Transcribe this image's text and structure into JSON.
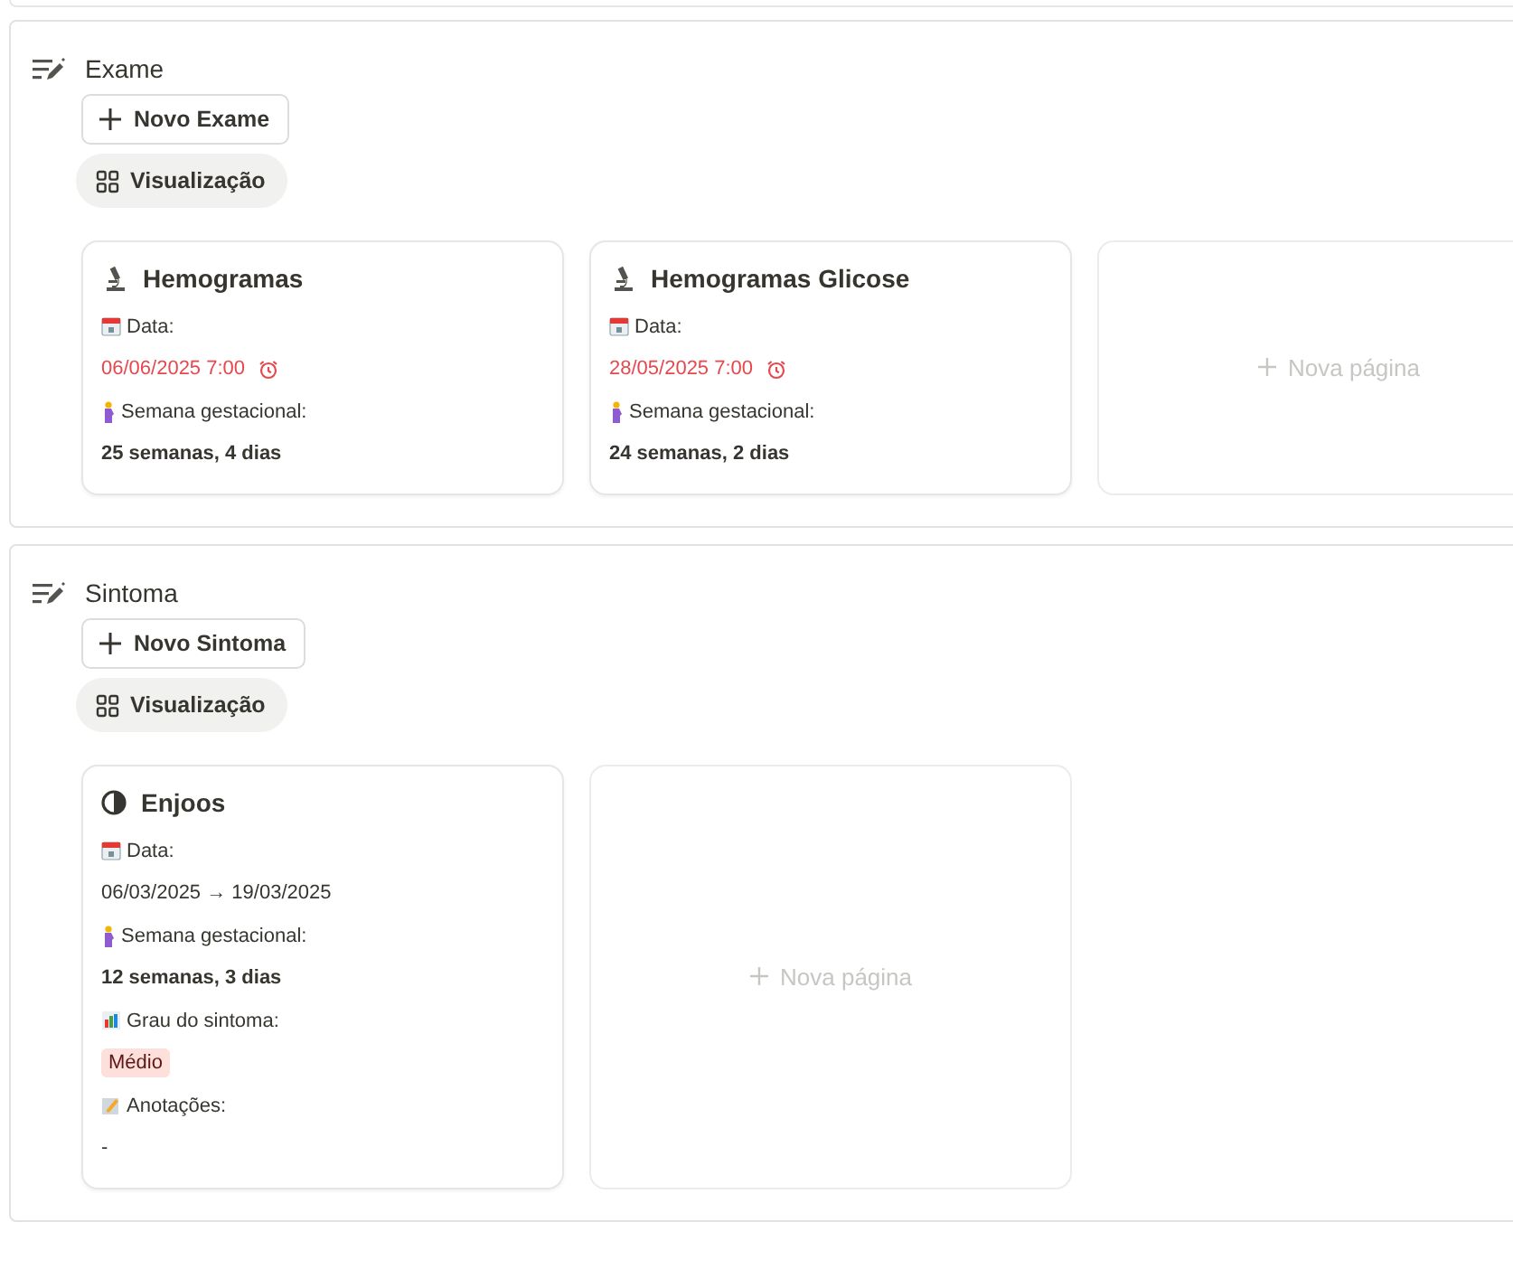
{
  "sections": [
    {
      "title": "Exame",
      "new_button": "Novo Exame",
      "view_button": "Visualização",
      "cards": [
        {
          "kind": "page",
          "title": "Hemogramas",
          "properties": [
            {
              "label": "Data:",
              "kind": "overdue-date",
              "value": "06/06/2025 7:00"
            },
            {
              "label": "Semana gestacional:",
              "kind": "strong",
              "value": "25 semanas, 4 dias"
            }
          ]
        },
        {
          "kind": "page",
          "title": "Hemogramas Glicose",
          "properties": [
            {
              "label": "Data:",
              "kind": "overdue-date",
              "value": "28/05/2025 7:00"
            },
            {
              "label": "Semana gestacional:",
              "kind": "strong",
              "value": "24 semanas, 2 dias"
            }
          ]
        },
        {
          "kind": "new",
          "label": "Nova página"
        }
      ]
    },
    {
      "title": "Sintoma",
      "new_button": "Novo Sintoma",
      "view_button": "Visualização",
      "cards": [
        {
          "kind": "page",
          "title": "Enjoos",
          "properties": [
            {
              "label": "Data:",
              "kind": "plain",
              "value": "06/03/2025 → 19/03/2025"
            },
            {
              "label": "Semana gestacional:",
              "kind": "strong",
              "value": "12 semanas, 3 dias"
            },
            {
              "label": "Grau do sintoma:",
              "kind": "tag",
              "value": "Médio",
              "color": "#fde0dc"
            },
            {
              "label": "Anotações:",
              "kind": "plain",
              "value": "-"
            }
          ]
        },
        {
          "kind": "new",
          "label": "Nova página"
        }
      ]
    }
  ]
}
